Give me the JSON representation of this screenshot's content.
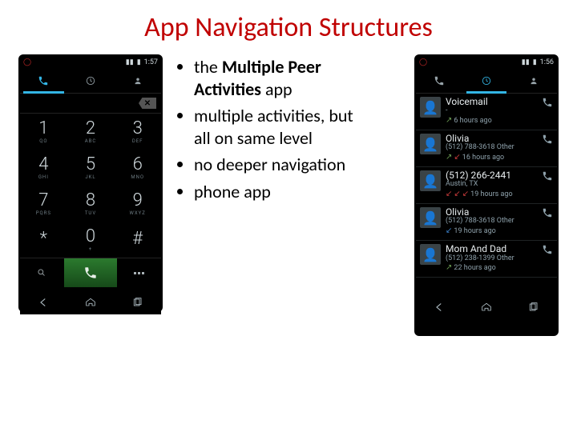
{
  "title": "App Navigation Structures",
  "bullets": {
    "b1_prefix": "the ",
    "b1_strong": "Multiple Peer Activities",
    "b1_suffix": " app",
    "b2": "multiple activities, but all on same level",
    "b3": "no deeper navigation",
    "b4": "phone app"
  },
  "phone1": {
    "status_time": "1:57",
    "backspace_x": "✕",
    "keys": [
      {
        "dig": "1",
        "sub": "QO"
      },
      {
        "dig": "2",
        "sub": "ABC"
      },
      {
        "dig": "3",
        "sub": "DEF"
      },
      {
        "dig": "4",
        "sub": "GHI"
      },
      {
        "dig": "5",
        "sub": "JKL"
      },
      {
        "dig": "6",
        "sub": "MNO"
      },
      {
        "dig": "7",
        "sub": "PQRS"
      },
      {
        "dig": "8",
        "sub": "TUV"
      },
      {
        "dig": "9",
        "sub": "WXYZ"
      },
      {
        "dig": "*",
        "sub": ""
      },
      {
        "dig": "0",
        "sub": "+"
      },
      {
        "dig": "#",
        "sub": ""
      }
    ]
  },
  "phone2": {
    "status_time": "1:56",
    "calls": [
      {
        "name": "Voicemail",
        "num": "-",
        "arrows": "out",
        "time": "6 hours ago"
      },
      {
        "name": "Olivia",
        "num": "(512) 788-3618 Other",
        "arrows": "outmiss",
        "time": "16 hours ago"
      },
      {
        "name": "(512) 266-2441",
        "num": "Austin, TX",
        "arrows": "miss3",
        "time": "19 hours ago"
      },
      {
        "name": "Olivia",
        "num": "(512) 788-3618 Other",
        "arrows": "in",
        "time": "19 hours ago"
      },
      {
        "name": "Mom And Dad",
        "num": "(512) 238-1399 Other",
        "arrows": "out",
        "time": "22 hours ago"
      }
    ]
  }
}
